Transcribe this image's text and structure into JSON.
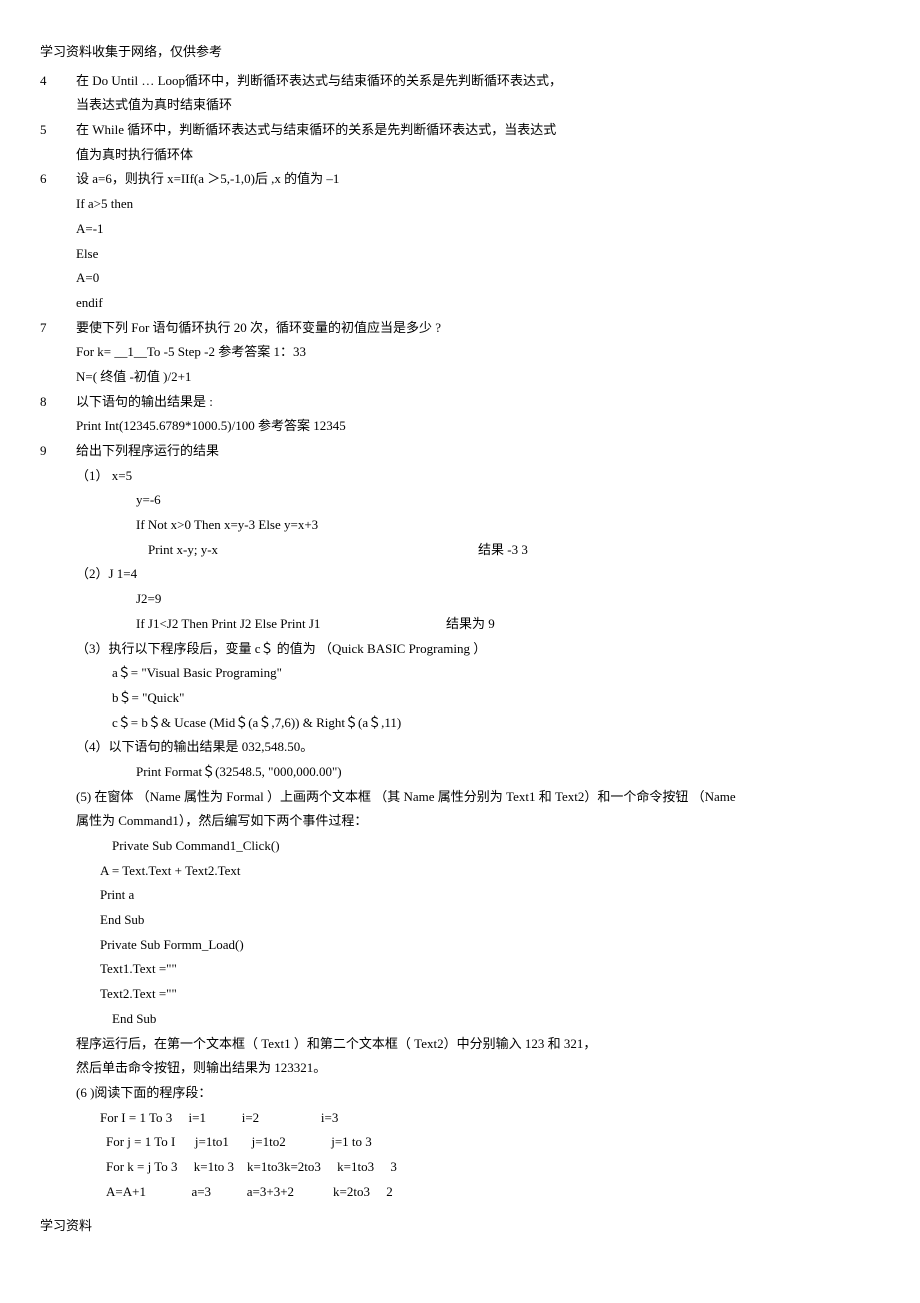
{
  "header": "学习资料收集于网络，仅供参考",
  "footer": "学习资料",
  "items": {
    "q4": {
      "num": "4",
      "l1": "在 Do Until    … Loop循环中，判断循环表达式与结束循环的关系是先判断循环表达式，",
      "l2": "当表达式值为真时结束循环"
    },
    "q5": {
      "num": "5",
      "l1": "在 While  循环中，判断循环表达式与结束循环的关系是先判断循环表达式，当表达式",
      "l2": "值为真时执行循环体"
    },
    "q6": {
      "num": "6",
      "l1": "设 a=6，则执行   x=IIf(a ＞5,-1,0)后 ,x 的值为  –1",
      "l2": "If     a>5 then",
      "l3": "A=-1",
      "l4": "Else",
      "l5": "A=0",
      "l6": "endif"
    },
    "q7": {
      "num": "7",
      "l1": "要使下列   For 语句循环执行    20 次，循环变量的初值应当是多少       ?",
      "l2": " For k=     __1__To -5 Step -2       参考答案       1：33",
      "l3": "N=( 终值 -初值 )/2+1"
    },
    "q8": {
      "num": "8",
      "l1": "以下语句的输出结果是    :",
      "l2": "Print Int(12345.6789*1000.5)/100         参考答案       12345"
    },
    "q9": {
      "num": "9",
      "l1": "给出下列程序运行的结果",
      "p1l1": "（1）   x=5",
      "p1l2": "y=-6",
      "p1l3": "If Not x>0 Then x=y-3 Else y=x+3",
      "p1l4a": "Print x-y; y-x",
      "p1l4b": "结果  -3    3",
      "p2l1": "（2）J 1=4",
      "p2l2": "J2=9",
      "p2l3a": "If J1<J2 Then Print J2 Else Print J1",
      "p2l3b": "结果为  9",
      "p3l1": "（3）执行以下程序段后，变量      c＄ 的值为   （Quick BASIC Programing    ）",
      "p3l2": "a＄= \"Visual Basic Programing\"",
      "p3l3": "b＄= \"Quick\"",
      "p3l4": "c＄= b＄& Ucase (Mid＄(a＄,7,6)) & Right＄(a＄,11)",
      "p4l1": "（4）以下语句的输出结果是      032,548.50。",
      "p4l2": "Print Format＄(32548.5, \"000,000.00\")",
      "p5l1": "(5)  在窗体 （Name 属性为  Formal ）上画两个文本框   （其  Name 属性分别为   Text1 和 Text2）和一个命令按钮   （Name",
      "p5l2": "属性为   Command1），然后编写如下两个事件过程：",
      "p5l3": "Private Sub Command1_Click()",
      "p5l4": "A = Text.Text + Text2.Text",
      "p5l5": "Print a",
      "p5l6": "End Sub",
      "p5l7": "Private Sub Formm_Load()",
      "p5l8": "Text1.Text =\"\"",
      "p5l9": "Text2.Text =\"\"",
      "p5l10": "End Sub",
      "p5l11": "程序运行后，在第一个文本框（      Text1 ）和第二个文本框（    Text2）中分别输入   123 和 321，",
      "p5l12": "然后单击命令按钮，则输出结果为        123321。",
      "p6l1": "(6 )阅读下面的程序段：",
      "p6l2": "For I = 1 To 3     i=1           i=2                   i=3",
      "p6l3": "For j = 1 To I      j=1to1       j=1to2              j=1 to 3",
      "p6l4": "For k = j To 3     k=1to 3    k=1to3k=2to3     k=1to3     3",
      "p6l5": "A=A+1              a=3           a=3+3+2            k=2to3     2"
    }
  }
}
